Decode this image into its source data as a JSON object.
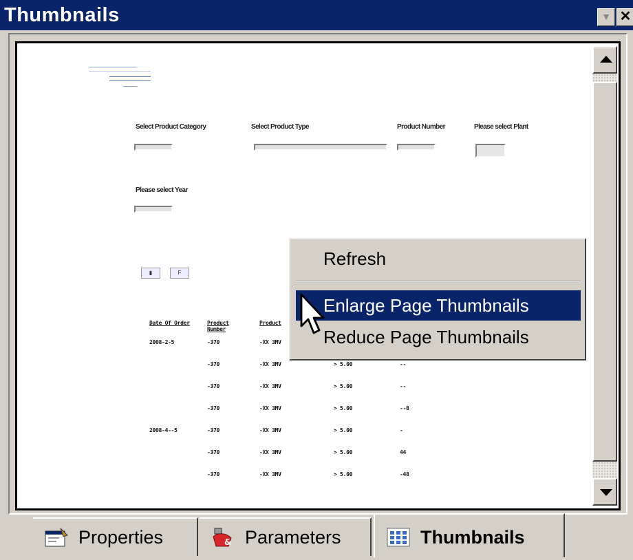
{
  "window": {
    "title": "Thumbnails"
  },
  "thumbnail": {
    "labels": {
      "category": "Select Product Category",
      "type": "Select Product Type",
      "number": "Product Number",
      "plant": "Please select Plant",
      "year": "Please select Year"
    },
    "table": {
      "headers": [
        "Date Of Order",
        "Product Number",
        "Product"
      ],
      "rows": [
        [
          "2008-2-5",
          "-370",
          "-XX 3MV",
          "",
          ""
        ],
        [
          "",
          "-370",
          "-XX 3MV",
          "> 5.00",
          "--"
        ],
        [
          "",
          "-370",
          "-XX 3MV",
          "> 5.00",
          "--"
        ],
        [
          "",
          "-370",
          "-XX 3MV",
          "> 5.00",
          "--8"
        ],
        [
          "2008-4--5",
          "-370",
          "-XX 3MV",
          "> 5.00",
          "-"
        ],
        [
          "",
          "-370",
          "-XX 3MV",
          "> 5.00",
          "44"
        ],
        [
          "",
          "-370",
          "-XX 3MV",
          "> 5.00",
          "-48"
        ]
      ]
    }
  },
  "context_menu": {
    "items": [
      "Refresh",
      "Enlarge Page Thumbnails",
      "Reduce Page Thumbnails"
    ]
  },
  "tabs": [
    "Properties",
    "Parameters",
    "Thumbnails"
  ],
  "colors": {
    "titlebar": "#0a246a",
    "highlight": "#0a246a",
    "chrome": "#d4d0c8"
  }
}
